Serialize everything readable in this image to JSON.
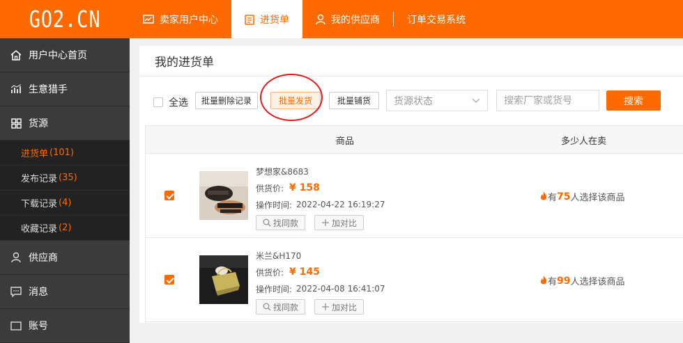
{
  "header": {
    "logo": "GO2.CN",
    "nav": [
      {
        "label": "卖家用户中心",
        "icon": "chart-window-icon"
      },
      {
        "label": "进货单",
        "icon": "clipboard-icon",
        "active": true
      },
      {
        "label": "我的供应商",
        "icon": "person-icon"
      },
      {
        "label": "订单交易系统",
        "icon": ""
      }
    ]
  },
  "sidebar": {
    "home": {
      "label": "用户中心首页",
      "icon": "home-icon"
    },
    "hunter": {
      "label": "生意猎手",
      "icon": "bar-chart-icon"
    },
    "source": {
      "label": "货源",
      "icon": "grid-icon"
    },
    "sub": [
      {
        "label": "进货单",
        "count": "(101)"
      },
      {
        "label": "发布记录",
        "count": "(35)"
      },
      {
        "label": "下载记录",
        "count": "(4)"
      },
      {
        "label": "收藏记录",
        "count": "(2)"
      }
    ],
    "supplier": {
      "label": "供应商",
      "icon": "person-icon"
    },
    "message": {
      "label": "消息",
      "icon": "message-icon"
    },
    "account": {
      "label": "账号",
      "icon": "account-icon"
    }
  },
  "page": {
    "title": "我的进货单",
    "select_all": "全选",
    "btn_delete": "批量删除记录",
    "btn_ship": "批量发货",
    "btn_list": "批量铺货",
    "status_placeholder": "货源状态",
    "search_placeholder": "搜索厂家或货号",
    "search_btn": "搜索"
  },
  "table": {
    "col_product": "商品",
    "col_sellers": "多少人在卖",
    "rows": [
      {
        "name": "梦想家&8683",
        "price_label": "供货价:",
        "price": "¥ 158",
        "time_label": "操作时间:",
        "time": "2022-04-22 16:19:27",
        "find_similar": "找同款",
        "add_compare": "加对比",
        "sellers_pre": "有",
        "sellers_count": "75",
        "sellers_post": "人选择该商品"
      },
      {
        "name": "米兰&H170",
        "price_label": "供货价:",
        "price": "¥ 145",
        "time_label": "操作时间:",
        "time": "2022-04-08 16:41:07",
        "find_similar": "找同款",
        "add_compare": "加对比",
        "sellers_pre": "有",
        "sellers_count": "99",
        "sellers_post": "人选择该商品"
      }
    ]
  },
  "colors": {
    "brand": "#ff6a00",
    "sidebar": "#333333",
    "annotation": "#e01b1b"
  }
}
